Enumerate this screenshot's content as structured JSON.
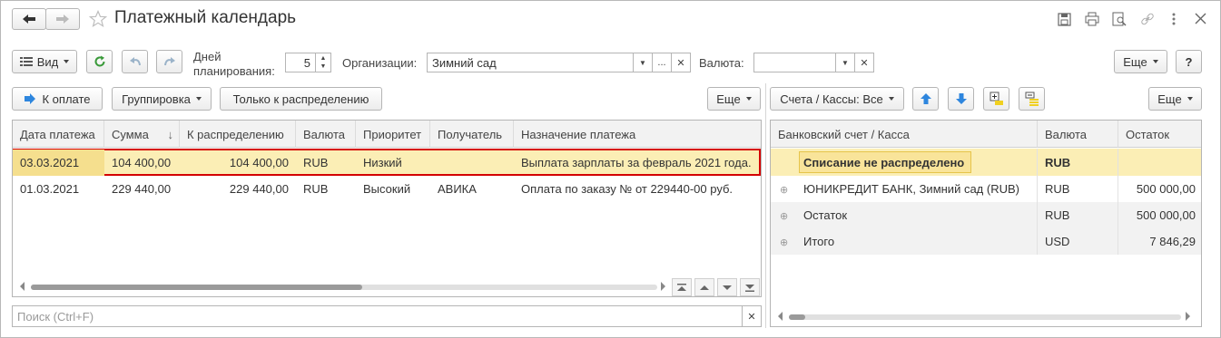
{
  "window": {
    "title": "Платежный календарь"
  },
  "toolbar": {
    "view_label": "Вид",
    "days_label_line1": "Дней",
    "days_label_line2": "планирования:",
    "days_value": "5",
    "org_label": "Организации:",
    "org_value": "Зимний сад",
    "org_more": "...",
    "currency_label": "Валюта:",
    "currency_value": "",
    "more_label": "Еще",
    "help_label": "?"
  },
  "left_panel": {
    "to_pay_label": "К оплате",
    "grouping_label": "Группировка",
    "only_distribution_label": "Только к распределению",
    "more_label": "Еще",
    "columns": [
      "Дата платежа",
      "Сумма",
      "К распределению",
      "Валюта",
      "Приоритет",
      "Получатель",
      "Назначение платежа"
    ],
    "sort_indicator": "↓",
    "rows": [
      [
        "03.03.2021",
        "104 400,00",
        "104 400,00",
        "RUB",
        "Низкий",
        "",
        "Выплата зарплаты за февраль 2021 года."
      ],
      [
        "01.03.2021",
        "229 440,00",
        "229 440,00",
        "RUB",
        "Высокий",
        "АВИКА",
        "Оплата по заказу № от  229440-00 руб."
      ]
    ],
    "search_placeholder": "Поиск (Ctrl+F)"
  },
  "right_panel": {
    "accounts_label": "Счета / Кассы: Все",
    "more_label": "Еще",
    "columns": [
      "Банковский счет / Касса",
      "Валюта",
      "Остаток"
    ],
    "rows": [
      {
        "name": "Списание не распределено",
        "currency": "RUB",
        "balance": ""
      },
      {
        "name": "ЮНИКРЕДИТ БАНК, Зимний сад (RUB)",
        "currency": "RUB",
        "balance": "500 000,00"
      },
      {
        "name": "Остаток",
        "currency": "RUB",
        "balance": "500 000,00"
      },
      {
        "name": "Итого",
        "currency": "USD",
        "balance": "7 846,29"
      }
    ]
  },
  "colors": {
    "selected_row": "#fbeeb5",
    "highlight_border": "#d40000",
    "accent_blue": "#2e86de",
    "green_refresh": "#3a9a3a"
  }
}
